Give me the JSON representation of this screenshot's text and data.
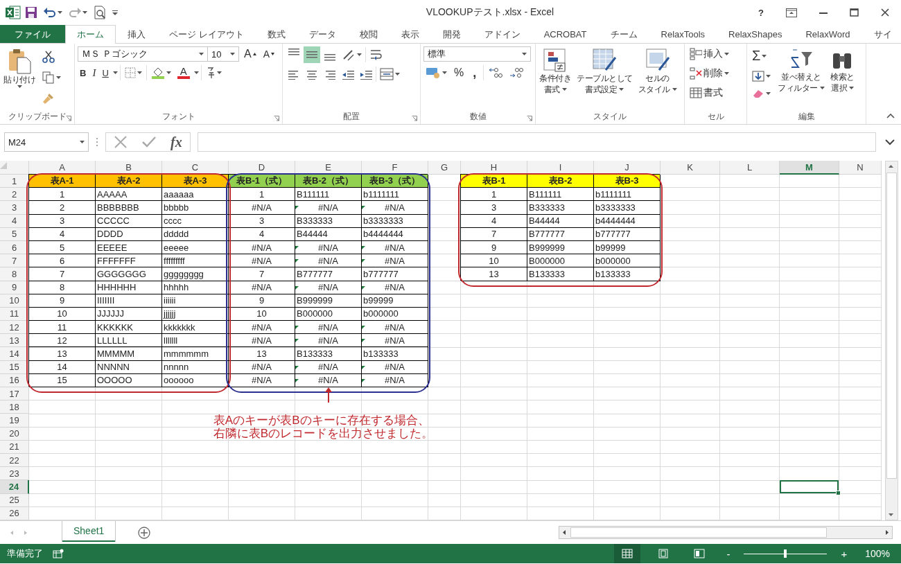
{
  "window": {
    "title": "VLOOKUPテスト.xlsx - Excel",
    "help": "?"
  },
  "tabs": [
    {
      "label": "ファイル",
      "kind": "file",
      "selected": false
    },
    {
      "label": "ホーム",
      "kind": "tab",
      "selected": true
    },
    {
      "label": "挿入",
      "kind": "tab",
      "selected": false
    },
    {
      "label": "ページ レイアウト",
      "kind": "tab",
      "selected": false
    },
    {
      "label": "数式",
      "kind": "tab",
      "selected": false
    },
    {
      "label": "データ",
      "kind": "tab",
      "selected": false
    },
    {
      "label": "校閲",
      "kind": "tab",
      "selected": false
    },
    {
      "label": "表示",
      "kind": "tab",
      "selected": false
    },
    {
      "label": "開発",
      "kind": "tab",
      "selected": false
    },
    {
      "label": "アドイン",
      "kind": "tab",
      "selected": false
    },
    {
      "label": "ACROBAT",
      "kind": "tab",
      "selected": false
    },
    {
      "label": "チーム",
      "kind": "tab",
      "selected": false
    },
    {
      "label": "RelaxTools",
      "kind": "tab",
      "selected": false
    },
    {
      "label": "RelaxShapes",
      "kind": "tab",
      "selected": false
    },
    {
      "label": "RelaxWord",
      "kind": "tab",
      "selected": false
    },
    {
      "label": "サイ",
      "kind": "tab",
      "selected": false
    }
  ],
  "ribbon": {
    "clipboard": {
      "paste": "貼り付け",
      "label": "クリップボード"
    },
    "font": {
      "name": "ＭＳ Ｐゴシック",
      "size": "10",
      "grow": "A",
      "shrink": "A",
      "bold": "B",
      "italic": "I",
      "underline": "U",
      "font_color": "A",
      "label": "フォント"
    },
    "alignment": {
      "vertical": [
        {
          "selected": false
        },
        {
          "selected": true
        },
        {
          "selected": false
        }
      ],
      "label": "配置"
    },
    "number": {
      "format": "標準",
      "percent": "%",
      "comma": ",",
      "label": "数値"
    },
    "styles": {
      "buttons": [
        {
          "lines": [
            "条件付き",
            "書式"
          ]
        },
        {
          "lines": [
            "テーブルとして",
            "書式設定"
          ]
        },
        {
          "lines": [
            "セルの",
            "スタイル"
          ]
        }
      ],
      "label": "スタイル"
    },
    "cells": {
      "buttons": [
        "挿入",
        "削除",
        "書式"
      ],
      "label": "セル"
    },
    "editing": {
      "sigma": "Σ",
      "buttons": [
        {
          "lines": [
            "並べ替えと",
            "フィルター"
          ]
        },
        {
          "lines": [
            "検索と",
            "選択"
          ]
        }
      ],
      "label": "編集"
    }
  },
  "formula_bar": {
    "name_box": "M24",
    "fx": "fx"
  },
  "sheet": {
    "columns": [
      {
        "label": "A",
        "selected": false
      },
      {
        "label": "B",
        "selected": false
      },
      {
        "label": "C",
        "selected": false
      },
      {
        "label": "D",
        "selected": false
      },
      {
        "label": "E",
        "selected": false
      },
      {
        "label": "F",
        "selected": false
      },
      {
        "label": "G",
        "selected": false
      },
      {
        "label": "H",
        "selected": false
      },
      {
        "label": "I",
        "selected": false
      },
      {
        "label": "J",
        "selected": false
      },
      {
        "label": "K",
        "selected": false
      },
      {
        "label": "L",
        "selected": false
      },
      {
        "label": "M",
        "selected": true
      },
      {
        "label": "N",
        "selected": false
      }
    ],
    "rows": [
      {
        "number": "1",
        "selected": false,
        "cells": [
          {
            "text": "表A-1",
            "kind": "header",
            "color": "#ffc000"
          },
          {
            "text": "表A-2",
            "kind": "header",
            "color": "#ffc000"
          },
          {
            "text": "表A-3",
            "kind": "header",
            "color": "#ffc000"
          },
          {
            "text": "表B-1（式）",
            "kind": "header",
            "color": "#92d050"
          },
          {
            "text": "表B-2（式）",
            "kind": "header",
            "color": "#92d050"
          },
          {
            "text": "表B-3（式）",
            "kind": "header",
            "color": "#92d050"
          },
          null,
          {
            "text": "表B-1",
            "kind": "header",
            "color": "#ffff00"
          },
          {
            "text": "表B-2",
            "kind": "header",
            "color": "#ffff00"
          },
          {
            "text": "表B-3",
            "kind": "header",
            "color": "#ffff00"
          }
        ]
      },
      {
        "number": "2",
        "selected": false,
        "cells": [
          {
            "text": "1",
            "centered": true
          },
          "AAAAA",
          "aaaaaa",
          {
            "text": "1",
            "centered": true
          },
          "B111111",
          "b1111111",
          null,
          {
            "text": "1",
            "centered": true
          },
          "B111111",
          "b1111111"
        ]
      },
      {
        "number": "3",
        "selected": false,
        "cells": [
          {
            "text": "2",
            "centered": true
          },
          "BBBBBBB",
          "bbbbb",
          {
            "text": "#N/A",
            "centered": true
          },
          {
            "text": "#N/A",
            "centered": true,
            "error_flag": true
          },
          {
            "text": "#N/A",
            "centered": true,
            "error_flag": true
          },
          null,
          {
            "text": "3",
            "centered": true
          },
          "B333333",
          "b3333333"
        ]
      },
      {
        "number": "4",
        "selected": false,
        "cells": [
          {
            "text": "3",
            "centered": true
          },
          "CCCCC",
          "cccc",
          {
            "text": "3",
            "centered": true
          },
          "B333333",
          "b3333333",
          null,
          {
            "text": "4",
            "centered": true
          },
          "B44444",
          "b4444444"
        ]
      },
      {
        "number": "5",
        "selected": false,
        "cells": [
          {
            "text": "4",
            "centered": true
          },
          "DDDD",
          "ddddd",
          {
            "text": "4",
            "centered": true
          },
          "B44444",
          "b4444444",
          null,
          {
            "text": "7",
            "centered": true
          },
          "B777777",
          "b777777"
        ]
      },
      {
        "number": "6",
        "selected": false,
        "cells": [
          {
            "text": "5",
            "centered": true
          },
          "EEEEE",
          "eeeee",
          {
            "text": "#N/A",
            "centered": true
          },
          {
            "text": "#N/A",
            "centered": true,
            "error_flag": true
          },
          {
            "text": "#N/A",
            "centered": true,
            "error_flag": true
          },
          null,
          {
            "text": "9",
            "centered": true
          },
          "B999999",
          "b99999"
        ]
      },
      {
        "number": "7",
        "selected": false,
        "cells": [
          {
            "text": "6",
            "centered": true
          },
          "FFFFFFF",
          "fffffffff",
          {
            "text": "#N/A",
            "centered": true
          },
          {
            "text": "#N/A",
            "centered": true,
            "error_flag": true
          },
          {
            "text": "#N/A",
            "centered": true,
            "error_flag": true
          },
          null,
          {
            "text": "10",
            "centered": true
          },
          "B000000",
          "b000000"
        ]
      },
      {
        "number": "8",
        "selected": false,
        "cells": [
          {
            "text": "7",
            "centered": true
          },
          "GGGGGGG",
          "gggggggg",
          {
            "text": "7",
            "centered": true
          },
          "B777777",
          "b777777",
          null,
          {
            "text": "13",
            "centered": true
          },
          "B133333",
          "b133333"
        ]
      },
      {
        "number": "9",
        "selected": false,
        "cells": [
          {
            "text": "8",
            "centered": true
          },
          "HHHHHH",
          "hhhhh",
          {
            "text": "#N/A",
            "centered": true
          },
          {
            "text": "#N/A",
            "centered": true,
            "error_flag": true
          },
          {
            "text": "#N/A",
            "centered": true,
            "error_flag": true
          }
        ]
      },
      {
        "number": "10",
        "selected": false,
        "cells": [
          {
            "text": "9",
            "centered": true
          },
          "IIIIIII",
          "iiiiii",
          {
            "text": "9",
            "centered": true
          },
          "B999999",
          "b99999"
        ]
      },
      {
        "number": "11",
        "selected": false,
        "cells": [
          {
            "text": "10",
            "centered": true
          },
          "JJJJJJ",
          "jjjjjj",
          {
            "text": "10",
            "centered": true
          },
          "B000000",
          "b000000"
        ]
      },
      {
        "number": "12",
        "selected": false,
        "cells": [
          {
            "text": "11",
            "centered": true
          },
          "KKKKKK",
          "kkkkkkk",
          {
            "text": "#N/A",
            "centered": true
          },
          {
            "text": "#N/A",
            "centered": true,
            "error_flag": true
          },
          {
            "text": "#N/A",
            "centered": true,
            "error_flag": true
          }
        ]
      },
      {
        "number": "13",
        "selected": false,
        "cells": [
          {
            "text": "12",
            "centered": true
          },
          "LLLLLL",
          "lllllll",
          {
            "text": "#N/A",
            "centered": true
          },
          {
            "text": "#N/A",
            "centered": true,
            "error_flag": true
          },
          {
            "text": "#N/A",
            "centered": true,
            "error_flag": true
          }
        ]
      },
      {
        "number": "14",
        "selected": false,
        "cells": [
          {
            "text": "13",
            "centered": true
          },
          "MMMMM",
          "mmmmmm",
          {
            "text": "13",
            "centered": true
          },
          "B133333",
          "b133333"
        ]
      },
      {
        "number": "15",
        "selected": false,
        "cells": [
          {
            "text": "14",
            "centered": true
          },
          "NNNNN",
          "nnnnn",
          {
            "text": "#N/A",
            "centered": true
          },
          {
            "text": "#N/A",
            "centered": true,
            "error_flag": true
          },
          {
            "text": "#N/A",
            "centered": true,
            "error_flag": true
          }
        ]
      },
      {
        "number": "16",
        "selected": false,
        "cells": [
          {
            "text": "15",
            "centered": true
          },
          "OOOOO",
          "oooooo",
          {
            "text": "#N/A",
            "centered": true
          },
          {
            "text": "#N/A",
            "centered": true,
            "error_flag": true
          },
          {
            "text": "#N/A",
            "centered": true,
            "error_flag": true
          }
        ]
      },
      {
        "number": "17",
        "selected": false
      },
      {
        "number": "18",
        "selected": false
      },
      {
        "number": "19",
        "selected": false
      },
      {
        "number": "20",
        "selected": false
      },
      {
        "number": "21",
        "selected": false
      },
      {
        "number": "22",
        "selected": false
      },
      {
        "number": "23",
        "selected": false
      },
      {
        "number": "24",
        "selected": true
      },
      {
        "number": "25",
        "selected": false
      },
      {
        "number": "26",
        "selected": false
      }
    ],
    "shapes": [
      {
        "kind": "outline",
        "color": "#c0282d"
      },
      {
        "kind": "outline",
        "color": "#2b2f8f"
      },
      {
        "kind": "outline",
        "color": "#c0282d"
      },
      {
        "kind": "arrow",
        "color": "#c0282d"
      }
    ],
    "annotation": {
      "lines": [
        "表Aのキーが表Bのキーに存在する場合、",
        "右隣に表Bのレコードを出力させました。"
      ],
      "color": "#c0282d"
    }
  },
  "sheet_tabs": [
    {
      "label": "Sheet1",
      "selected": true
    }
  ],
  "status_bar": {
    "status": "準備完了",
    "views": [
      {
        "kind": "normal",
        "selected": true
      },
      {
        "kind": "page-layout",
        "selected": false
      },
      {
        "kind": "page-break",
        "selected": false
      }
    ],
    "zoom_out": "-",
    "zoom_in": "+",
    "zoom": {
      "level": 0.5,
      "reading": "100%"
    }
  }
}
